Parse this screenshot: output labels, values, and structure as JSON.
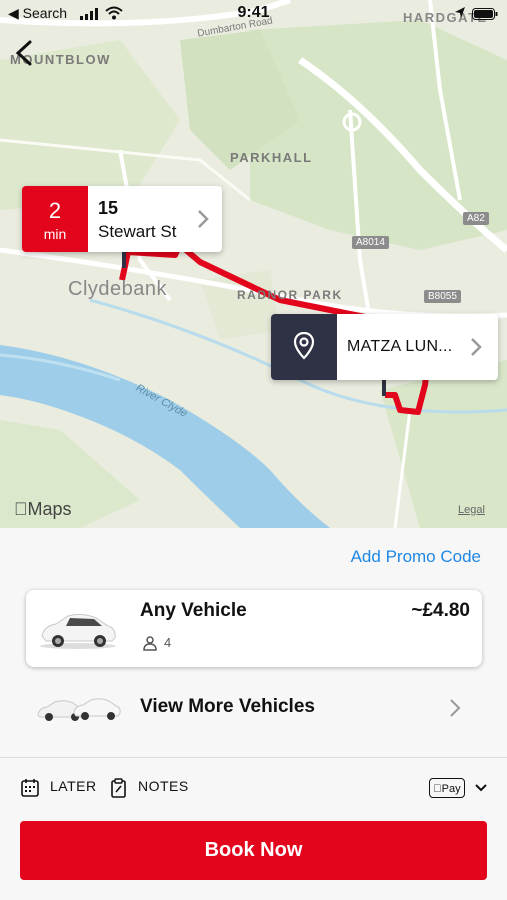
{
  "status_bar": {
    "back_app": "◀ Search",
    "time": "9:41"
  },
  "map": {
    "labels": {
      "mountblow": "MOUNTBLOW",
      "parkhall": "PARKHALL",
      "clydebank": "Clydebank",
      "radnor_park": "RADNOR PARK",
      "hardgate": "HARDGATE",
      "dumbarton_road": "Dumbarton Road",
      "river": "River Clyde"
    },
    "road_signs": {
      "a82": "A82",
      "a8014": "A8014",
      "b8055": "B8055"
    },
    "attribution": "Maps",
    "legal": "Legal"
  },
  "pickup": {
    "eta_value": "2",
    "eta_unit": "min",
    "line1": "15",
    "line2": "Stewart St"
  },
  "dropoff": {
    "name": "MATZA LUN..."
  },
  "promo_label": "Add Promo Code",
  "vehicle": {
    "name": "Any Vehicle",
    "price": "~£4.80",
    "passengers": "4"
  },
  "more_vehicles_label": "View More Vehicles",
  "options": {
    "later": "LATER",
    "notes": "NOTES",
    "pay": "Pay"
  },
  "book_label": "Book Now",
  "colors": {
    "accent": "#e3051b",
    "link": "#1e88e5",
    "pin_bg": "#2f3144",
    "route": "#e3051b"
  }
}
